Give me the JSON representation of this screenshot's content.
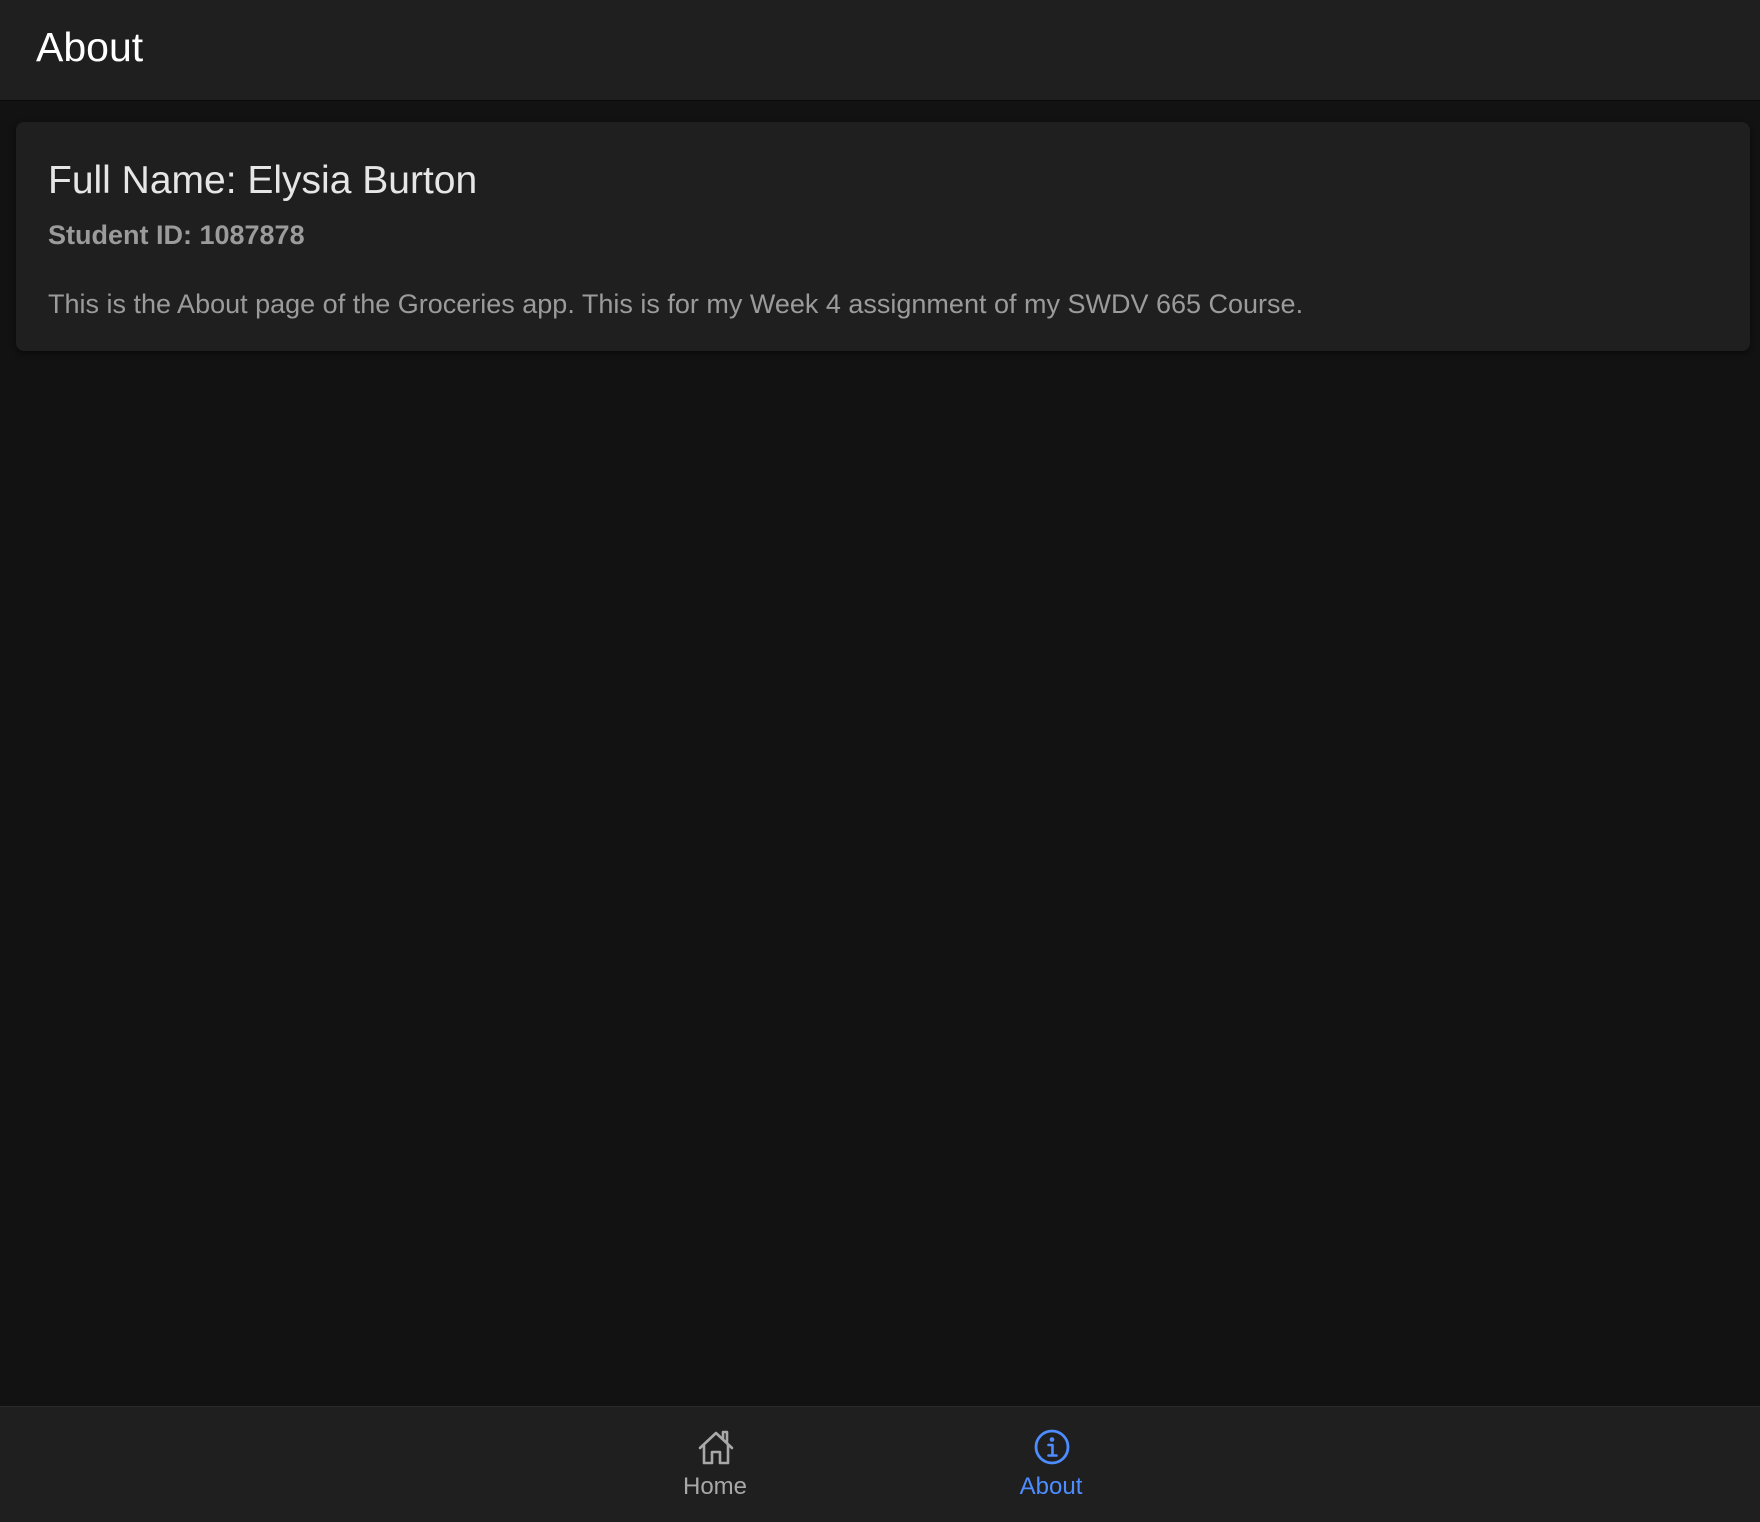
{
  "header": {
    "title": "About"
  },
  "card": {
    "title": "Full Name: Elysia Burton",
    "subtitle": "Student ID: 1087878",
    "content": "This is the About page of the Groceries app. This is for my Week 4 assignment of my SWDV 665 Course."
  },
  "tabs": [
    {
      "label": "Home",
      "icon": "home-icon",
      "selected": false
    },
    {
      "label": "About",
      "icon": "info-icon",
      "selected": true
    }
  ],
  "colors": {
    "background": "#121212",
    "surface": "#1f1f1f",
    "accent": "#4d8dff",
    "inactive_tab": "#a8a8a8"
  }
}
